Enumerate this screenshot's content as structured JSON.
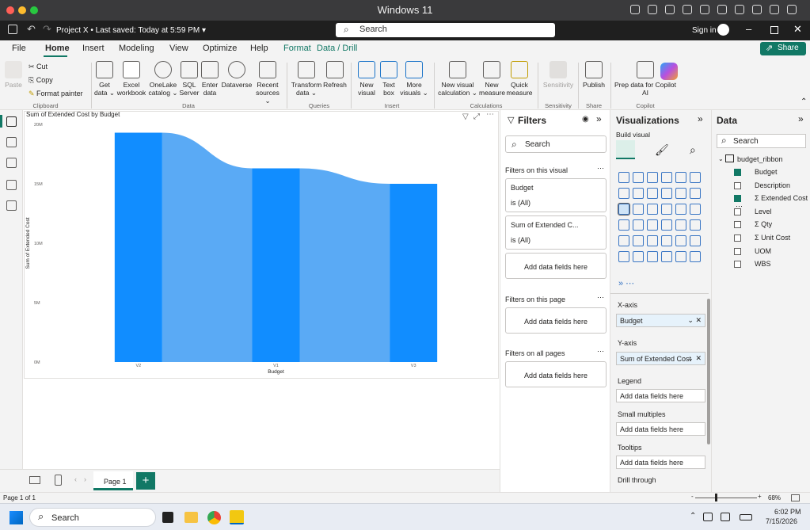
{
  "mac": {
    "title": "Windows 11"
  },
  "titlebar": {
    "project": "Project X • Last saved: Today at 5:59 PM ▾",
    "search": "Search",
    "signin": "Sign in"
  },
  "menu": {
    "tabs": [
      "File",
      "Home",
      "Insert",
      "Modeling",
      "View",
      "Optimize",
      "Help",
      "Format",
      "Data / Drill"
    ],
    "share": "Share"
  },
  "ribbon": {
    "clipboard": {
      "paste": "Paste",
      "cut": "Cut",
      "copy": "Copy",
      "format_painter": "Format painter",
      "label": "Clipboard"
    },
    "data": {
      "items": [
        "Get data ⌄",
        "Excel workbook",
        "OneLake catalog ⌄",
        "SQL Server",
        "Enter data",
        "Dataverse",
        "Recent sources ⌄"
      ],
      "label": "Data"
    },
    "queries": {
      "items": [
        "Transform data ⌄",
        "Refresh"
      ],
      "label": "Queries"
    },
    "insert": {
      "items": [
        "New visual",
        "Text box",
        "More visuals ⌄"
      ],
      "label": "Insert"
    },
    "calculations": {
      "items": [
        "New visual calculation ⌄",
        "New measure",
        "Quick measure"
      ],
      "label": "Calculations"
    },
    "sensitivity": {
      "items": [
        "Sensitivity"
      ],
      "label": "Sensitivity"
    },
    "share": {
      "items": [
        "Publish"
      ],
      "label": "Share"
    },
    "copilot": {
      "items": [
        "Prep data for Copilot AI"
      ],
      "label": "Copilot"
    }
  },
  "page": {
    "tab": "Page 1",
    "add": "+"
  },
  "filters": {
    "title": "Filters",
    "search": "Search",
    "on_visual": "Filters on this visual",
    "cards": [
      {
        "name": "Budget",
        "value": "is (All)"
      },
      {
        "name": "Sum of Extended C...",
        "value": "is (All)"
      }
    ],
    "add": "Add data fields here",
    "on_page": "Filters on this page",
    "on_all": "Filters on all pages"
  },
  "viz": {
    "title": "Visualizations",
    "build": "Build visual",
    "xaxis": "X-axis",
    "xaxis_field": "Budget",
    "yaxis": "Y-axis",
    "yaxis_field": "Sum of Extended Cost",
    "legend": "Legend",
    "small_multiples": "Small multiples",
    "tooltips": "Tooltips",
    "add": "Add data fields here",
    "drill": "Drill through"
  },
  "data": {
    "title": "Data",
    "search": "Search",
    "table": "budget_ribbon",
    "fields": [
      {
        "name": "Budget",
        "checked": true,
        "sigma": false
      },
      {
        "name": "Description",
        "checked": false,
        "sigma": false
      },
      {
        "name": "Extended Cost ⋯",
        "checked": true,
        "sigma": true
      },
      {
        "name": "Level",
        "checked": false,
        "sigma": false
      },
      {
        "name": "Qty",
        "checked": false,
        "sigma": true
      },
      {
        "name": "Unit Cost",
        "checked": false,
        "sigma": true
      },
      {
        "name": "UOM",
        "checked": false,
        "sigma": false
      },
      {
        "name": "WBS",
        "checked": false,
        "sigma": false
      }
    ]
  },
  "status": {
    "page": "Page 1 of 1",
    "zoom": "68%"
  },
  "taskbar": {
    "search": "Search",
    "time": "6:02 PM",
    "date": "7/15/2026"
  },
  "chart_data": {
    "type": "bar",
    "title": "Sum of Extended Cost by Budget",
    "xlabel": "Budget",
    "ylabel": "Sum of Extended Cost",
    "categories": [
      "V2",
      "V1",
      "V3"
    ],
    "values": [
      19300000,
      16300000,
      15000000
    ],
    "ylim": [
      0,
      20000000
    ],
    "yticks": [
      "0M",
      "5M",
      "10M",
      "15M",
      "20M"
    ],
    "bar_color": "#118DFF",
    "ribbon_color": "#5AAAF5",
    "grid": false
  }
}
